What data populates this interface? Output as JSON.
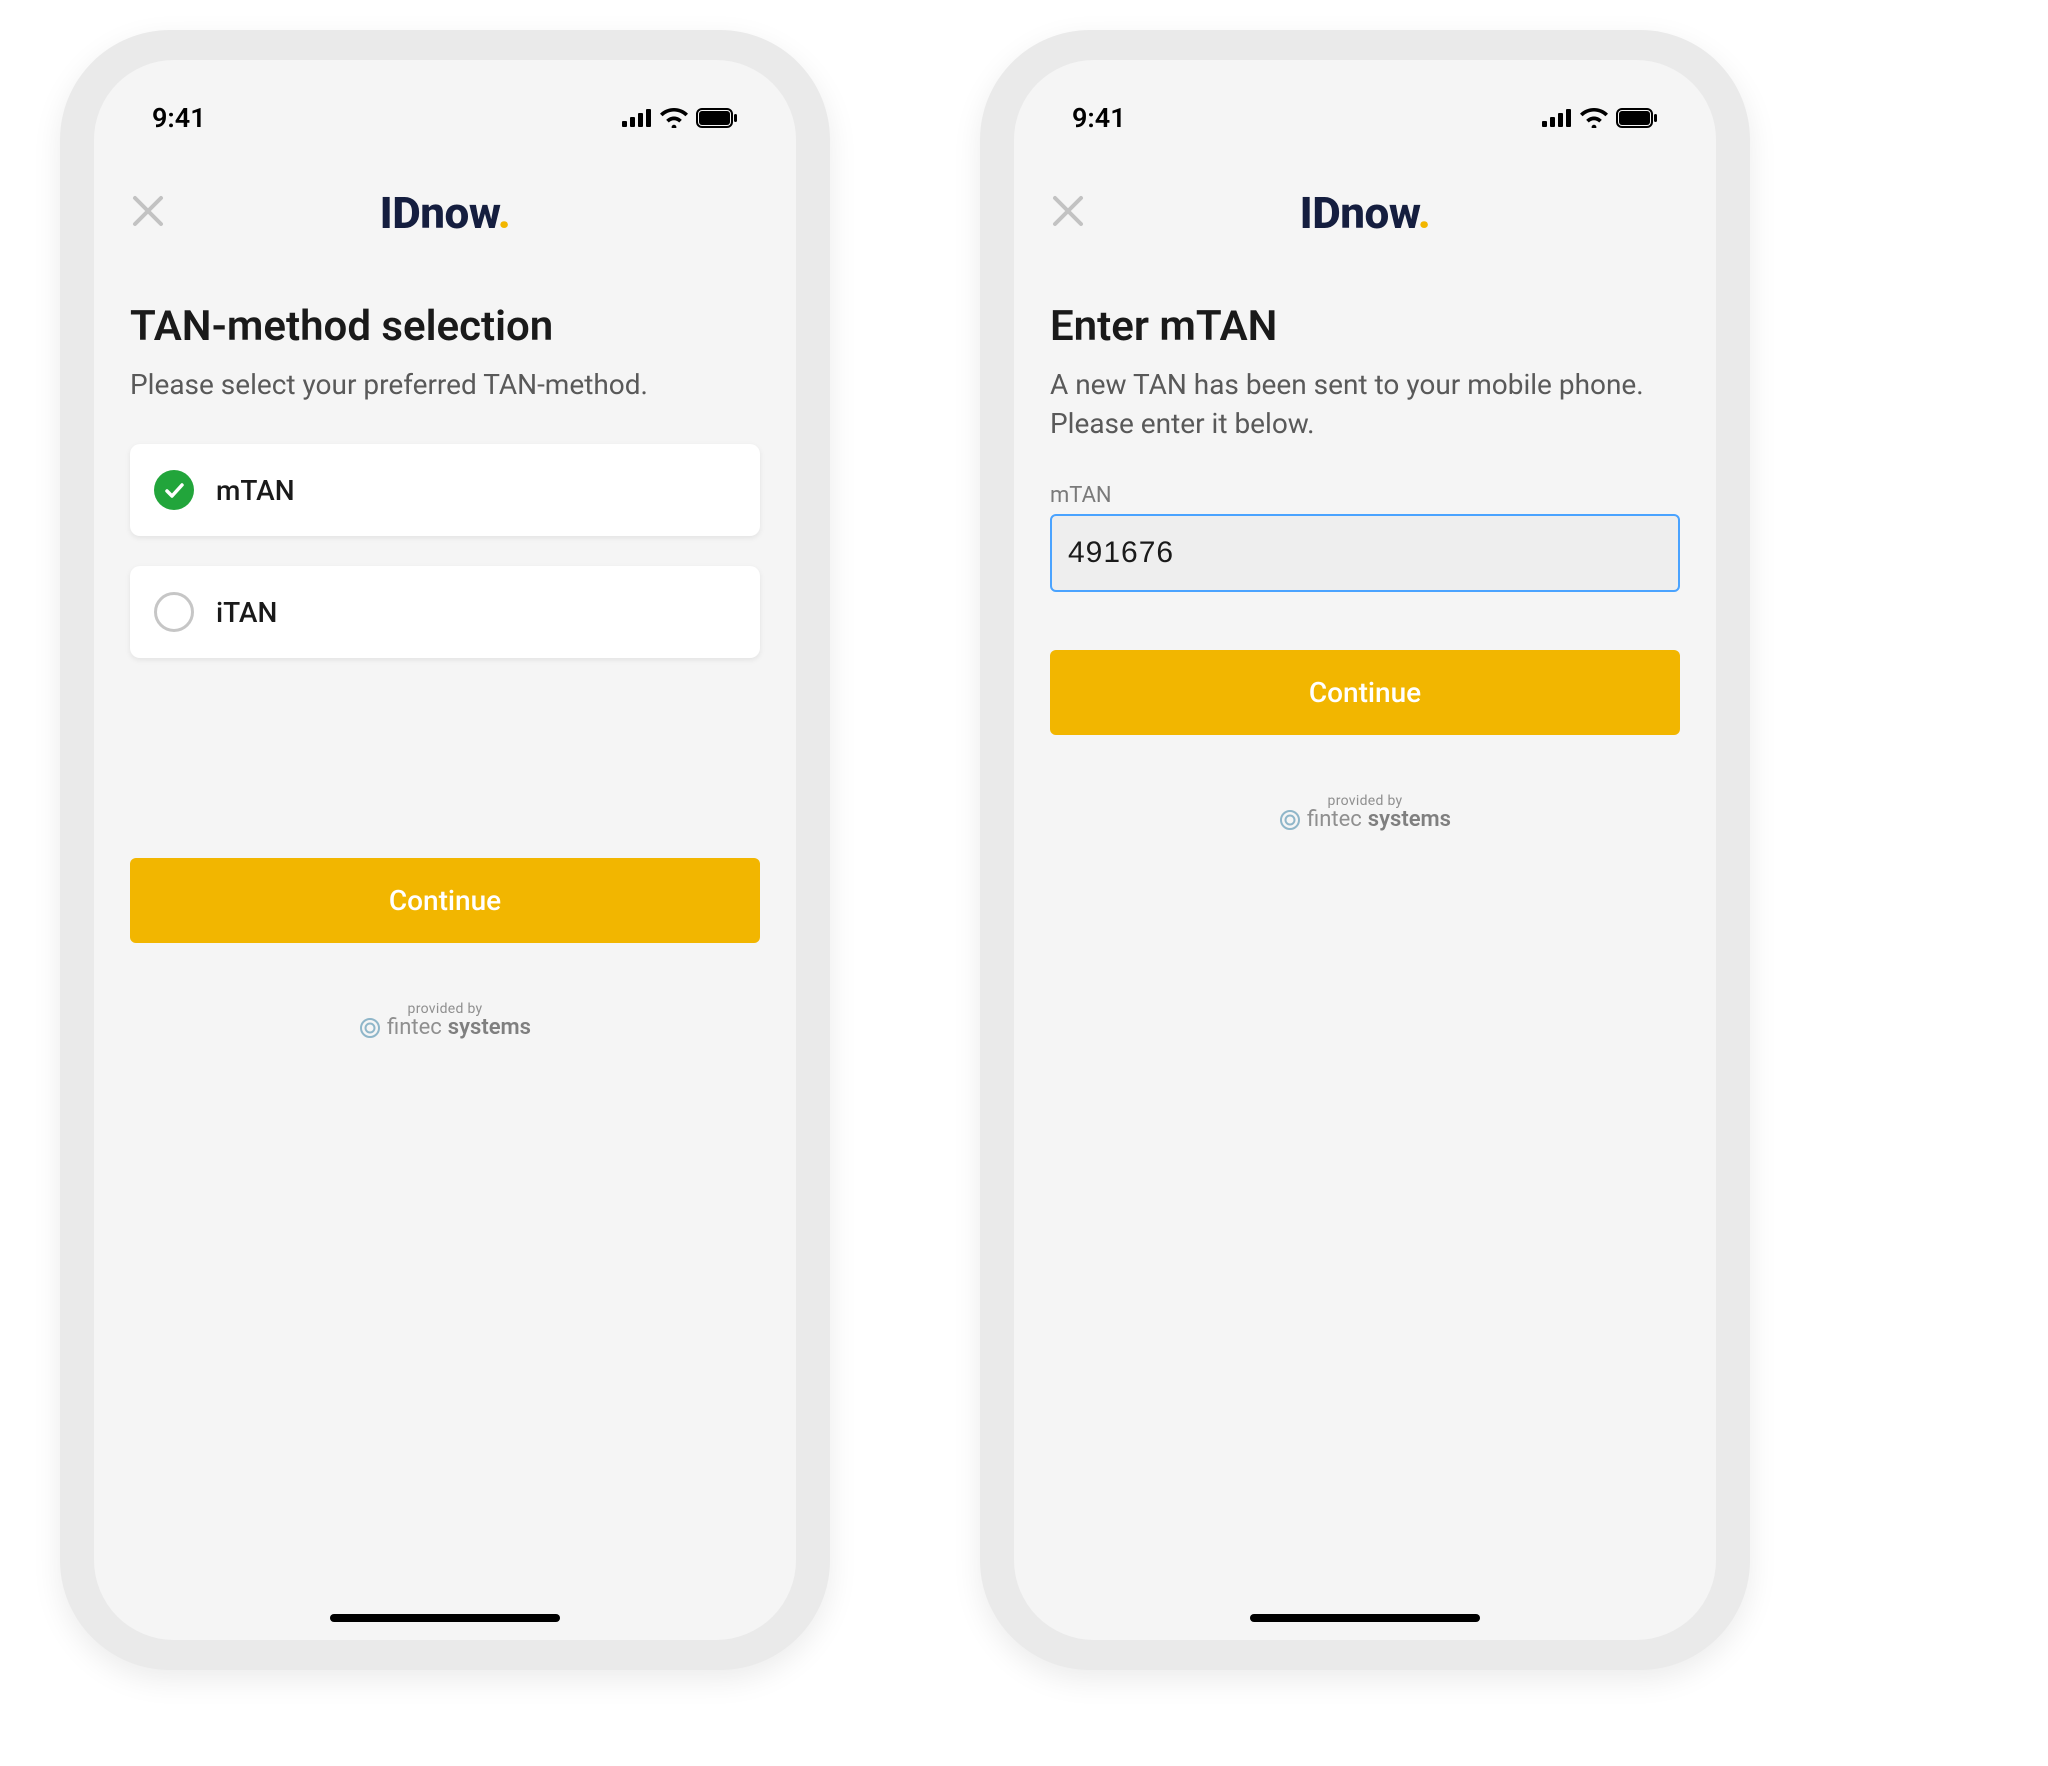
{
  "statusbar": {
    "time": "9:41"
  },
  "logo": {
    "text": "IDnow",
    "dot": "."
  },
  "colors": {
    "brand_dark": "#151e3f",
    "accent_yellow": "#f2b600",
    "success_green": "#22a53b",
    "input_focus_blue": "#4aa3ff"
  },
  "provided_by": {
    "top": "provided by",
    "brand_prefix": "fintec",
    "brand_suffix": "systems"
  },
  "left": {
    "title": "TAN-method selection",
    "subtitle": "Please select your preferred TAN-method.",
    "options": [
      {
        "label": "mTAN",
        "selected": true
      },
      {
        "label": "iTAN",
        "selected": false
      }
    ],
    "continue_label": "Continue"
  },
  "right": {
    "title": "Enter mTAN",
    "subtitle": "A new TAN has been sent to your mobile phone. Please enter it below.",
    "field_label": "mTAN",
    "field_value": "491676",
    "continue_label": "Continue"
  }
}
